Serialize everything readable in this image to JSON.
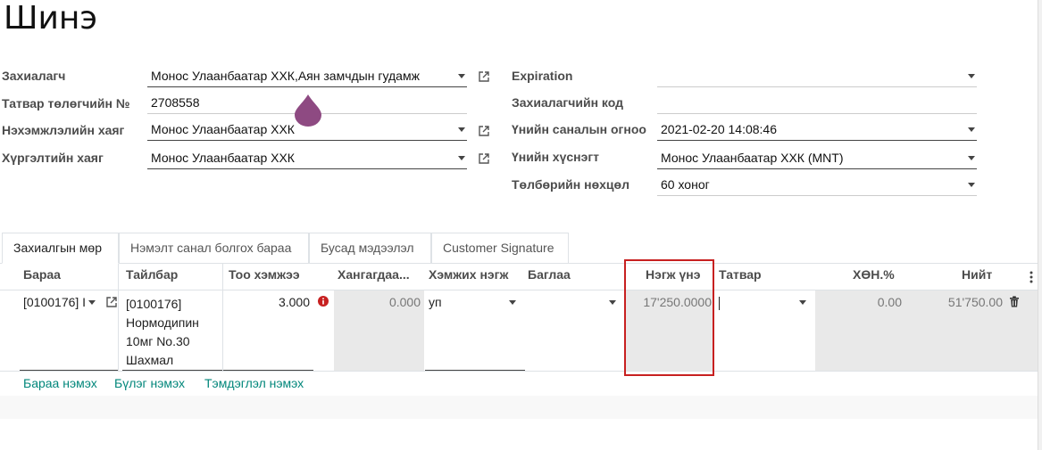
{
  "page": {
    "title": "Шинэ"
  },
  "form": {
    "left": [
      {
        "label": "Захиалагч",
        "value": "Монос Улаанбаатар ХХК,Аян замчдын гудамж",
        "kind": "select",
        "external": true
      },
      {
        "label": "Татвар төлөгчийн №",
        "value": "2708558",
        "kind": "text",
        "external": false
      },
      {
        "label": "Нэхэмжлэлийн хаяг",
        "value": "Монос Улаанбаатар ХХК",
        "kind": "select",
        "external": true
      },
      {
        "label": "Хүргэлтийн хаяг",
        "value": "Монос Улаанбаатар ХХК",
        "kind": "select",
        "external": true
      }
    ],
    "right": [
      {
        "label": "Expiration",
        "value": "",
        "kind": "select"
      },
      {
        "label": "Захиалагчийн код",
        "value": "",
        "kind": "text"
      },
      {
        "label": "Үнийн саналын огноо",
        "value": "2021-02-20 14:08:46",
        "kind": "select"
      },
      {
        "label": "Үнийн хүснэгт",
        "value": "Монос Улаанбаатар ХХК (MNT)",
        "kind": "select"
      },
      {
        "label": "Төлбөрийн нөхцөл",
        "value": "60 хоног",
        "kind": "select"
      }
    ]
  },
  "tabs": [
    "Захиалгын мөр",
    "Нэмэлт санал болгох бараа",
    "Бусад мэдээлэл",
    "Customer Signature"
  ],
  "table": {
    "headers": {
      "product": "Бараа",
      "description": "Тайлбар",
      "quantity": "Тоо хэмжээ",
      "delivered": "Хангагдаа...",
      "uom": "Хэмжих нэгж",
      "package": "Баглаа",
      "unit_price": "Нэгж үнэ",
      "tax": "Татвар",
      "discount": "ХӨН.%",
      "subtotal": "Нийт"
    },
    "rows": [
      {
        "product": "[0100176] I",
        "description": [
          "[0100176]",
          "Нормодипин",
          "10мг No.30",
          "Шахмал"
        ],
        "quantity": "3.000",
        "delivered": "0.000",
        "uom": "уп",
        "package": "",
        "unit_price": "17'250.0000",
        "tax": "",
        "discount": "0.00",
        "subtotal": "51'750.00"
      }
    ],
    "add_links": [
      "Бараа нэмэх",
      "Бүлэг нэмэх",
      "Тэмдэглэл нэмэх"
    ]
  },
  "colors": {
    "link": "#00867a",
    "highlight_box": "#c72020",
    "drop_marker": "#8e4a82"
  }
}
